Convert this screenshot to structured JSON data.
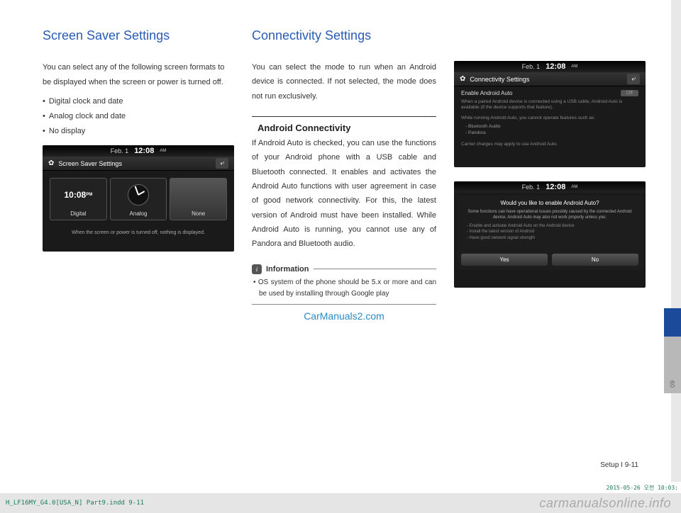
{
  "col1": {
    "heading": "Screen Saver Settings",
    "intro": "You can select any of the following screen formats to be displayed when the screen or power is turned off.",
    "bullets": [
      "Digital clock and date",
      "Analog clock and date",
      "No display"
    ],
    "screenshot": {
      "status_date": "Feb.  1",
      "status_time": "12:08",
      "status_ampm": "AM",
      "header_title": "Screen Saver Settings",
      "digital_time": "10:08",
      "digital_ampm": "PM",
      "opt_digital": "Digital",
      "opt_analog": "Analog",
      "opt_none": "None",
      "caption": "When the screen or power is turned off, nothing is displayed."
    }
  },
  "col2": {
    "heading": "Connectivity Settings",
    "intro": "You can select the mode to run when an Android device is connected. If not selected, the mode does not run exclusively.",
    "sub_heading": "Android Connectivity",
    "sub_body": "If Android Auto is checked, you can use the functions of your Android phone with a USB cable and Bluetooth connected. It enables and activates the Android Auto functions with user agreement in case of good network connectivity. For this, the latest version of Android must have been installed. While Android Auto is running, you cannot use any of Pandora and Bluetooth audio.",
    "info_label": "Information",
    "info_body": "•  OS system of the phone should be 5.x or more and can be used by installing through Google play",
    "watermark": "CarManuals2.com"
  },
  "col3": {
    "screenshot1": {
      "status_date": "Feb.  1",
      "status_time": "12:08",
      "status_ampm": "AM",
      "header_title": "Connectivity Settings",
      "row_label": "Enable Android Auto",
      "toggle": "Off",
      "desc1": "When a paired Android device is connected using a USB cable, Android Auto is available (if the device supports that feature).",
      "desc2": "While running Android Auto, you cannot operate features such as:",
      "bullets": [
        "Bluetooth Audio",
        "Pandora"
      ],
      "desc3": "Carrier charges may apply to use Android Auto."
    },
    "screenshot2": {
      "status_date": "Feb.  1",
      "status_time": "12:08",
      "status_ampm": "AM",
      "question": "Would you like to enable Android Auto?",
      "msg": "Some functions can have operational issues possibly caused by the connected Android device. Android Auto may also not work properly unless you:",
      "tips": [
        "Enable and activate Android Auto on the Android device",
        "Install the latest version of Android",
        "Have good network signal strength"
      ],
      "yes": "Yes",
      "no": "No"
    }
  },
  "side_tab": "09",
  "page_label": "Setup I 9-11",
  "footer_left": "H_LF16MY_G4.0[USA_N] Part9.indd   9-11",
  "footer_brand": "carmanualsonline.info",
  "footer_date": "2015-05-26   오전 10:03:"
}
